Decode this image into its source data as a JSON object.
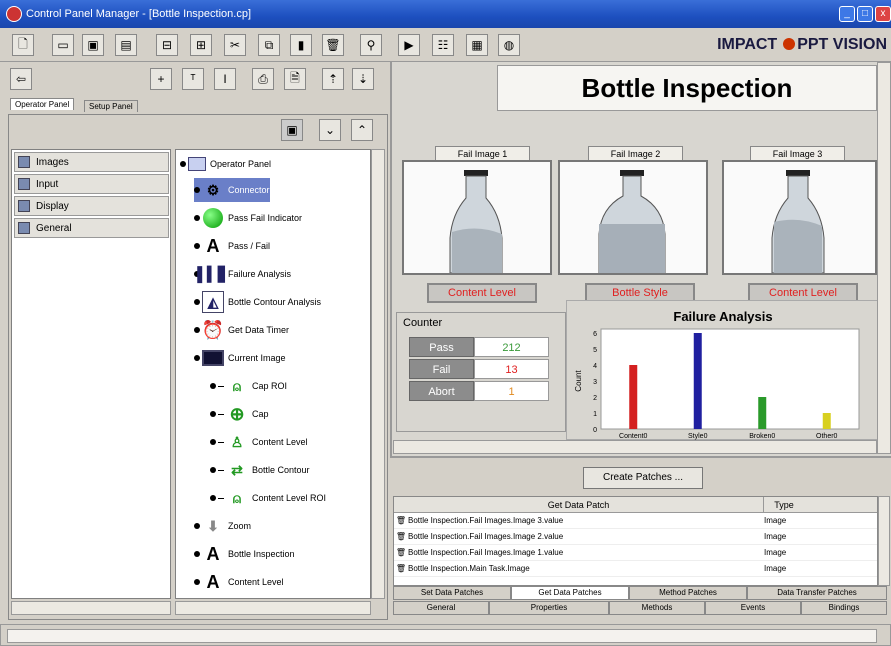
{
  "window": {
    "title": "Control Panel Manager - [Bottle Inspection.cp]",
    "min": "_",
    "max": "□",
    "close": "x"
  },
  "brand": {
    "name": "IMPACT",
    "suffix": "PPT VISION"
  },
  "left": {
    "tabs": [
      "Operator Panel",
      "Setup Panel"
    ],
    "categories": [
      "Images",
      "Input",
      "Display",
      "General"
    ]
  },
  "tree": {
    "root": "Operator Panel",
    "items": [
      "Connector",
      "Pass Fail Indicator",
      "Pass / Fail",
      "Failure Analysis",
      "Bottle Contour Analysis",
      "Get Data Timer",
      "Current Image",
      "Cap ROI",
      "Cap",
      "Content Level",
      "Bottle Contour",
      "Content Level ROI",
      "Zoom",
      "Bottle Inspection",
      "Content Level"
    ]
  },
  "main": {
    "title": "Bottle Inspection",
    "images": [
      {
        "label": "Fail Image 1",
        "status": "Content Level"
      },
      {
        "label": "Fail Image 2",
        "status": "Bottle Style"
      },
      {
        "label": "Fail Image 3",
        "status": "Content Level"
      }
    ],
    "counter": {
      "title": "Counter",
      "rows": [
        {
          "label": "Pass",
          "value": "212",
          "color": "#3a9a3a"
        },
        {
          "label": "Fail",
          "value": "13",
          "color": "#e02020"
        },
        {
          "label": "Abort",
          "value": "1",
          "color": "#e08a20"
        }
      ]
    },
    "create_patches": "Create Patches ..."
  },
  "chart_data": {
    "type": "bar",
    "title": "Failure Analysis",
    "ylabel": "Count",
    "categories": [
      "Content0",
      "Style0",
      "Broken0",
      "Other0"
    ],
    "values": [
      4,
      6,
      2,
      1
    ],
    "colors": [
      "#d42020",
      "#2020a0",
      "#2a9a2a",
      "#d8d020"
    ],
    "yticks": [
      "0",
      "1",
      "2",
      "3",
      "4",
      "5",
      "6"
    ],
    "ylim": [
      0,
      6
    ]
  },
  "patches": {
    "headers": [
      "Get Data Patch",
      "Type"
    ],
    "rows": [
      {
        "name": "Bottle Inspection.Fail Images.Image 3.value",
        "type": "Image"
      },
      {
        "name": "Bottle Inspection.Fail Images.Image 2.value",
        "type": "Image"
      },
      {
        "name": "Bottle Inspection.Fail Images.Image 1.value",
        "type": "Image"
      },
      {
        "name": "Bottle Inspection.Main Task.Image",
        "type": "Image"
      }
    ]
  },
  "bottom_tabs_top": [
    "Set Data Patches",
    "Get Data Patches",
    "Method Patches",
    "Data Transfer Patches"
  ],
  "bottom_tabs": [
    "General",
    "Properties",
    "Methods",
    "Events",
    "Bindings"
  ]
}
